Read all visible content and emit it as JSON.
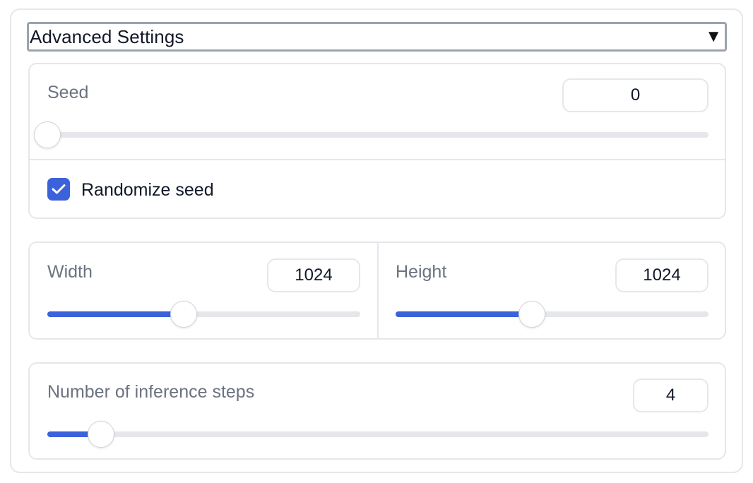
{
  "accordion": {
    "title": "Advanced Settings",
    "caret": "▼"
  },
  "seed": {
    "label": "Seed",
    "value": "0",
    "slider_fraction": 0.0
  },
  "randomize": {
    "label": "Randomize seed",
    "checked": true
  },
  "width": {
    "label": "Width",
    "value": "1024",
    "slider_fraction": 0.435
  },
  "height": {
    "label": "Height",
    "value": "1024",
    "slider_fraction": 0.435
  },
  "steps": {
    "label": "Number of inference steps",
    "value": "4",
    "slider_fraction": 0.081
  },
  "colors": {
    "accent": "#3b62db",
    "track": "#e5e7eb",
    "border": "#e5e7eb"
  }
}
